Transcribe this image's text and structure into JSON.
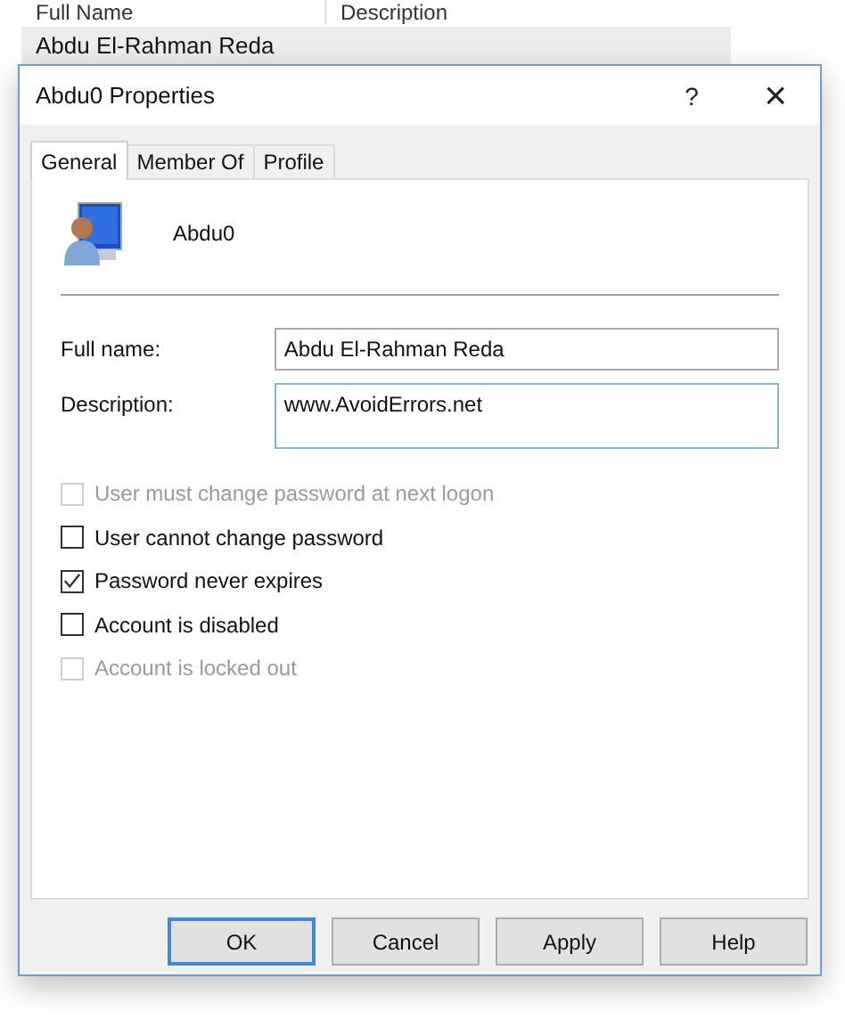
{
  "background_list": {
    "columns": [
      "Full Name",
      "Description"
    ],
    "rows": [
      {
        "full_name": "Abdu El-Rahman Reda",
        "selected": true
      }
    ]
  },
  "window": {
    "title": "Abdu0 Properties",
    "help": "?",
    "close": "×"
  },
  "tabs": [
    {
      "label": "General",
      "selected": true
    },
    {
      "label": "Member Of",
      "selected": false
    },
    {
      "label": "Profile",
      "selected": false
    }
  ],
  "user": {
    "name": "Abdu0"
  },
  "fields": [
    {
      "label": "Full name:",
      "value": "Abdu El-Rahman Reda",
      "kind": "single"
    },
    {
      "label": "Description:",
      "value": "www.AvoidErrors.net",
      "kind": "multi"
    }
  ],
  "options": [
    {
      "label": "User must change password at next logon",
      "checked": false,
      "disabled": true
    },
    {
      "label": "User cannot change password",
      "checked": false,
      "disabled": false
    },
    {
      "label": "Password never expires",
      "checked": true,
      "disabled": false
    },
    {
      "label": "Account is disabled",
      "checked": false,
      "disabled": false
    },
    {
      "label": "Account is locked out",
      "checked": false,
      "disabled": true
    }
  ],
  "buttons": [
    {
      "label": "OK",
      "default": true
    },
    {
      "label": "Cancel",
      "default": false
    },
    {
      "label": "Apply",
      "default": false
    },
    {
      "label": "Help",
      "default": false
    }
  ]
}
